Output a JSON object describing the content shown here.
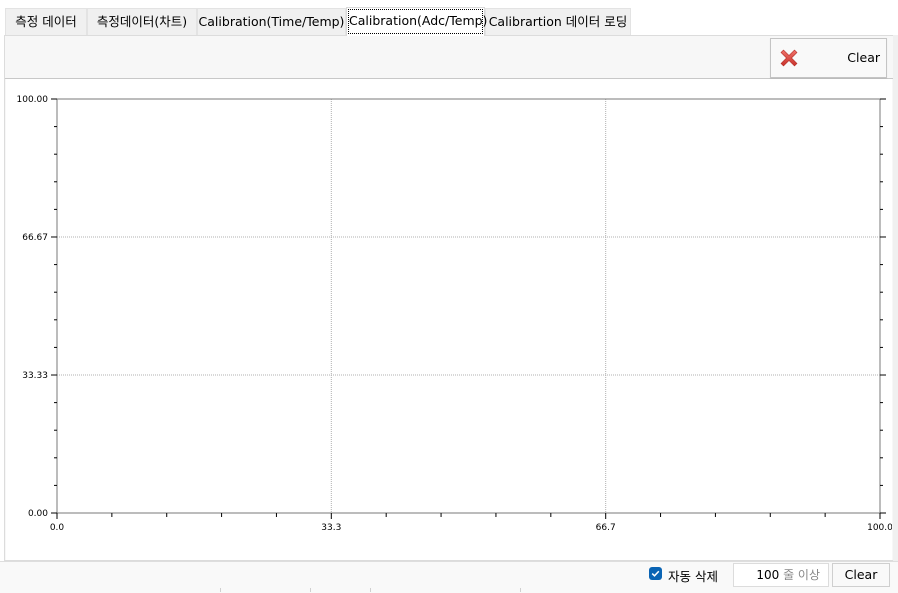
{
  "tabs": [
    {
      "label": "측정 데이터",
      "active": false
    },
    {
      "label": "측정데이터(차트)",
      "active": false
    },
    {
      "label": "Calibration(Time/Temp)",
      "active": false
    },
    {
      "label": "Calibration(Adc/Temp)",
      "active": true
    },
    {
      "label": "Calibrartion 데이터 로딩",
      "active": false
    }
  ],
  "toolbar": {
    "clear_label": "Clear",
    "clear_icon": "red-x-icon"
  },
  "chart_data": {
    "type": "line",
    "title": "",
    "xlabel": "",
    "ylabel": "",
    "xlim": [
      0.0,
      100.0
    ],
    "ylim": [
      0.0,
      100.0
    ],
    "x_ticks": [
      "0.0",
      "33.3",
      "66.7",
      "100.0"
    ],
    "x_tick_values": [
      0,
      33.33,
      66.67,
      100
    ],
    "y_ticks": [
      "0.00",
      "33.33",
      "66.67",
      "100.00"
    ],
    "y_tick_values": [
      0,
      33.33,
      66.67,
      100
    ],
    "minor_subdivisions": 5,
    "grid": true,
    "grid_style": "dotted",
    "series": []
  },
  "bottom": {
    "auto_delete_checked": true,
    "auto_delete_label": "자동 삭제",
    "row_count_value": "100",
    "row_count_unit": "줄 이상",
    "clear_label": "Clear"
  },
  "colors": {
    "accent": "#0a64b4",
    "clear_icon": "#d9403a",
    "axis": "#7a7a7a",
    "grid": "#b0b0b0"
  }
}
